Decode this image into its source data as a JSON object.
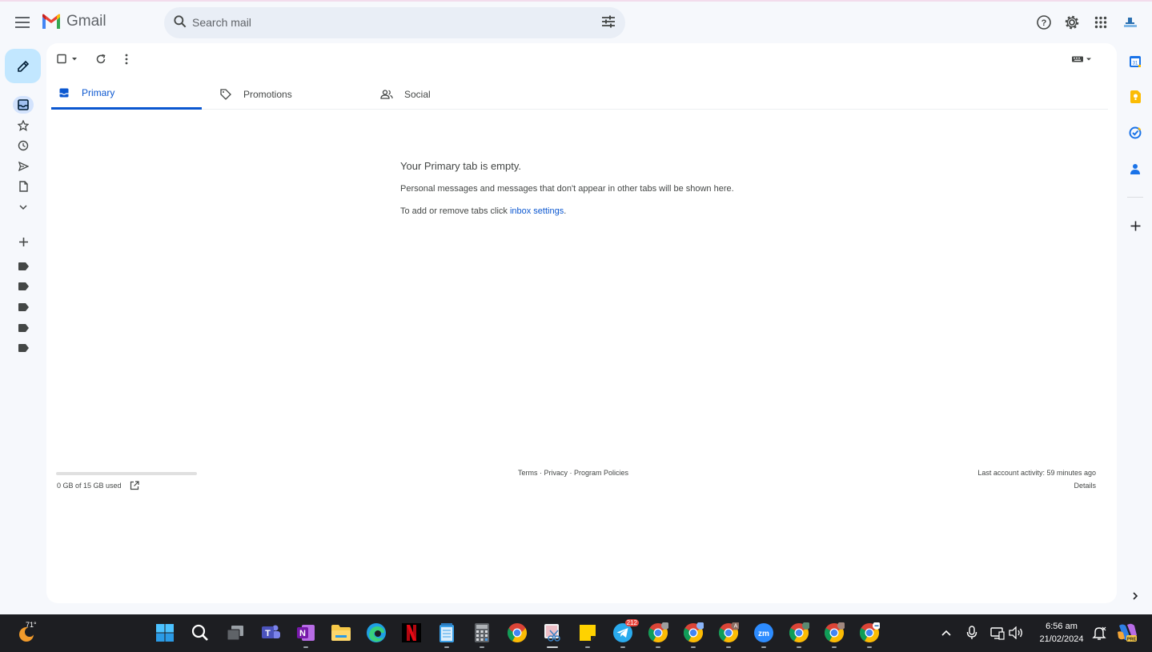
{
  "app": {
    "name": "Gmail"
  },
  "search": {
    "placeholder": "Search mail"
  },
  "tabs": [
    {
      "label": "Primary",
      "icon": "inbox-icon",
      "active": true
    },
    {
      "label": "Promotions",
      "icon": "tag-icon",
      "active": false
    },
    {
      "label": "Social",
      "icon": "people-icon",
      "active": false
    }
  ],
  "empty_state": {
    "title": "Your Primary tab is empty.",
    "line1": "Personal messages and messages that don't appear in other tabs will be shown here.",
    "line2_prefix": "To add or remove tabs click ",
    "line2_link": "inbox settings",
    "line2_suffix": "."
  },
  "footer": {
    "storage": "0 GB of 15 GB used",
    "storage_fraction": 0,
    "links": "Terms · Privacy · Program Policies",
    "activity": "Last account activity: 59 minutes ago",
    "details": "Details"
  },
  "taskbar": {
    "weather_temp": "71°",
    "telegram_badge": "212",
    "time": "6:56 am",
    "date": "21/02/2024",
    "chrome_profile_letter": "A",
    "zoom_label": "zm"
  },
  "colors": {
    "accent": "#0b57d0",
    "compose_bg": "#c2e7ff",
    "app_bg": "#f6f8fc",
    "taskbar_bg": "#1d1e22"
  }
}
